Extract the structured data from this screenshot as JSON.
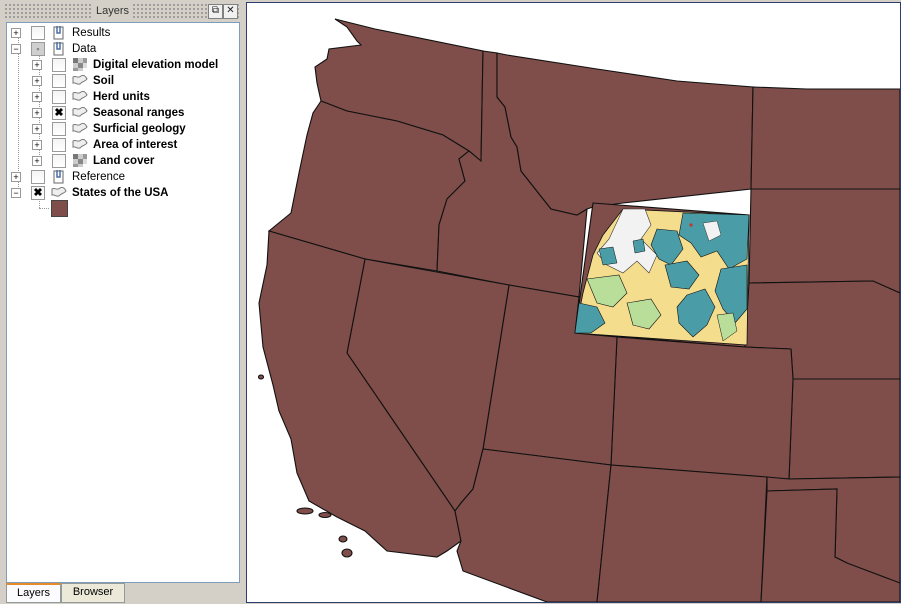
{
  "panel": {
    "title": "Layers",
    "float_button": "⧉",
    "close_button": "✕"
  },
  "tree": [
    {
      "label": "Results",
      "expand": "+",
      "checked": "",
      "icon": "group-icon",
      "bold": false
    },
    {
      "label": "Data",
      "expand": "−",
      "checked": "▪",
      "icon": "group-icon",
      "bold": false
    },
    {
      "label": "Digital elevation model",
      "expand": "+",
      "checked": "",
      "icon": "raster-icon",
      "bold": true
    },
    {
      "label": "Soil",
      "expand": "+",
      "checked": "",
      "icon": "polygon-layer-icon",
      "bold": true
    },
    {
      "label": "Herd units",
      "expand": "+",
      "checked": "",
      "icon": "polygon-layer-icon",
      "bold": true
    },
    {
      "label": "Seasonal ranges",
      "expand": "+",
      "checked": "✖",
      "icon": "polygon-layer-icon",
      "bold": true
    },
    {
      "label": "Surficial geology",
      "expand": "+",
      "checked": "",
      "icon": "polygon-layer-icon",
      "bold": true
    },
    {
      "label": "Area of interest",
      "expand": "+",
      "checked": "",
      "icon": "polygon-layer-icon",
      "bold": true
    },
    {
      "label": "Land cover",
      "expand": "+",
      "checked": "",
      "icon": "raster-icon",
      "bold": true
    },
    {
      "label": "Reference",
      "expand": "+",
      "checked": "",
      "icon": "group-icon",
      "bold": false
    },
    {
      "label": "States of the USA",
      "expand": "−",
      "checked": "✖",
      "icon": "polygon-layer-icon",
      "bold": true
    }
  ],
  "legend": {
    "swatch_color": "#7f4e4a"
  },
  "tabs": {
    "layers": "Layers",
    "browser": "Browser"
  },
  "colors": {
    "states_fill": "#7f4e4a",
    "geology_teal": "#4a9ca6",
    "geology_yellow": "#f5dd8e",
    "geology_green": "#b9de9a",
    "geology_white": "#f2f2f2"
  }
}
